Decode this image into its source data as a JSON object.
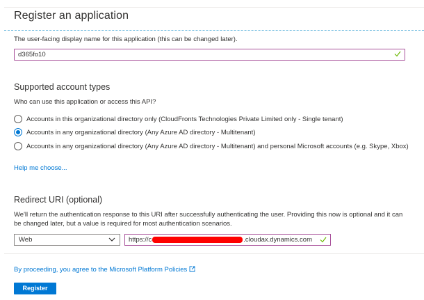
{
  "page": {
    "title": "Register an application"
  },
  "name_field": {
    "description": "The user-facing display name for this application (this can be changed later).",
    "value": "d365fo10"
  },
  "account_types": {
    "title": "Supported account types",
    "question": "Who can use this application or access this API?",
    "options": [
      {
        "label": "Accounts in this organizational directory only (CloudFronts Technologies Private Limited only - Single tenant)",
        "checked": false
      },
      {
        "label": "Accounts in any organizational directory (Any Azure AD directory - Multitenant)",
        "checked": true
      },
      {
        "label": "Accounts in any organizational directory (Any Azure AD directory - Multitenant) and personal Microsoft accounts (e.g. Skype, Xbox)",
        "checked": false
      }
    ],
    "help_link": "Help me choose..."
  },
  "redirect": {
    "title": "Redirect URI (optional)",
    "description": "We'll return the authentication response to this URI after successfully authenticating the user. Providing this now is optional and it can be changed later, but a value is required for most authentication scenarios.",
    "platform": "Web",
    "uri_prefix": "https://c",
    "uri_suffix": ".cloudax.dynamics.com"
  },
  "footer": {
    "policy_text": "By proceeding, you agree to the Microsoft Platform Policies",
    "register_label": "Register"
  },
  "colors": {
    "accent": "#0078d4",
    "focus_border": "#a8509a",
    "valid": "#6bb700",
    "redaction": "#ff0000"
  }
}
